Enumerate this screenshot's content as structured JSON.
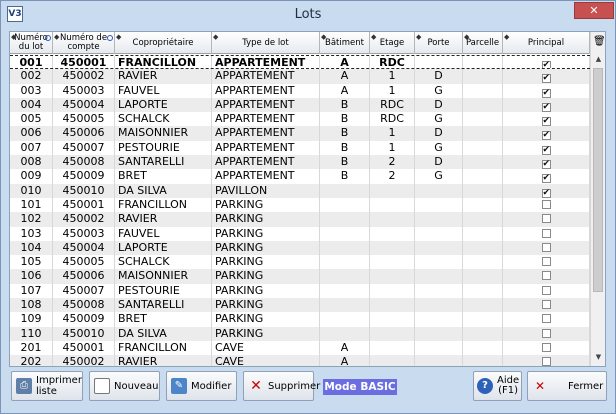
{
  "window": {
    "title": "Lots",
    "app_icon": "V3"
  },
  "columns": [
    {
      "label": "Numéro du lot",
      "key": "num"
    },
    {
      "label": "Numéro de compte",
      "key": "compte"
    },
    {
      "label": "Copropriétaire",
      "key": "prop"
    },
    {
      "label": "Type de lot",
      "key": "type"
    },
    {
      "label": "Bâtiment",
      "key": "bat"
    },
    {
      "label": "Etage",
      "key": "etage"
    },
    {
      "label": "Porte",
      "key": "porte"
    },
    {
      "label": "Parcelle",
      "key": "parc"
    },
    {
      "label": "Principal",
      "key": "princ"
    }
  ],
  "rows": [
    {
      "num": "001",
      "compte": "450001",
      "prop": "FRANCILLON",
      "type": "APPARTEMENT",
      "bat": "A",
      "etage": "RDC",
      "porte": "",
      "parc": "",
      "princ": true,
      "selected": true
    },
    {
      "num": "002",
      "compte": "450002",
      "prop": "RAVIER",
      "type": "APPARTEMENT",
      "bat": "A",
      "etage": "1",
      "porte": "D",
      "parc": "",
      "princ": true
    },
    {
      "num": "003",
      "compte": "450003",
      "prop": "FAUVEL",
      "type": "APPARTEMENT",
      "bat": "A",
      "etage": "1",
      "porte": "G",
      "parc": "",
      "princ": true
    },
    {
      "num": "004",
      "compte": "450004",
      "prop": "LAPORTE",
      "type": "APPARTEMENT",
      "bat": "B",
      "etage": "RDC",
      "porte": "D",
      "parc": "",
      "princ": true
    },
    {
      "num": "005",
      "compte": "450005",
      "prop": "SCHALCK",
      "type": "APPARTEMENT",
      "bat": "B",
      "etage": "RDC",
      "porte": "G",
      "parc": "",
      "princ": true
    },
    {
      "num": "006",
      "compte": "450006",
      "prop": "MAISONNIER",
      "type": "APPARTEMENT",
      "bat": "B",
      "etage": "1",
      "porte": "D",
      "parc": "",
      "princ": true
    },
    {
      "num": "007",
      "compte": "450007",
      "prop": "PESTOURIE",
      "type": "APPARTEMENT",
      "bat": "B",
      "etage": "1",
      "porte": "G",
      "parc": "",
      "princ": true
    },
    {
      "num": "008",
      "compte": "450008",
      "prop": "SANTARELLI",
      "type": "APPARTEMENT",
      "bat": "B",
      "etage": "2",
      "porte": "D",
      "parc": "",
      "princ": true
    },
    {
      "num": "009",
      "compte": "450009",
      "prop": "BRET",
      "type": "APPARTEMENT",
      "bat": "B",
      "etage": "2",
      "porte": "G",
      "parc": "",
      "princ": true
    },
    {
      "num": "010",
      "compte": "450010",
      "prop": "DA SILVA",
      "type": "PAVILLON",
      "bat": "",
      "etage": "",
      "porte": "",
      "parc": "",
      "princ": true
    },
    {
      "num": "101",
      "compte": "450001",
      "prop": "FRANCILLON",
      "type": "PARKING",
      "bat": "",
      "etage": "",
      "porte": "",
      "parc": "",
      "princ": false
    },
    {
      "num": "102",
      "compte": "450002",
      "prop": "RAVIER",
      "type": "PARKING",
      "bat": "",
      "etage": "",
      "porte": "",
      "parc": "",
      "princ": false
    },
    {
      "num": "103",
      "compte": "450003",
      "prop": "FAUVEL",
      "type": "PARKING",
      "bat": "",
      "etage": "",
      "porte": "",
      "parc": "",
      "princ": false
    },
    {
      "num": "104",
      "compte": "450004",
      "prop": "LAPORTE",
      "type": "PARKING",
      "bat": "",
      "etage": "",
      "porte": "",
      "parc": "",
      "princ": false
    },
    {
      "num": "105",
      "compte": "450005",
      "prop": "SCHALCK",
      "type": "PARKING",
      "bat": "",
      "etage": "",
      "porte": "",
      "parc": "",
      "princ": false
    },
    {
      "num": "106",
      "compte": "450006",
      "prop": "MAISONNIER",
      "type": "PARKING",
      "bat": "",
      "etage": "",
      "porte": "",
      "parc": "",
      "princ": false
    },
    {
      "num": "107",
      "compte": "450007",
      "prop": "PESTOURIE",
      "type": "PARKING",
      "bat": "",
      "etage": "",
      "porte": "",
      "parc": "",
      "princ": false
    },
    {
      "num": "108",
      "compte": "450008",
      "prop": "SANTARELLI",
      "type": "PARKING",
      "bat": "",
      "etage": "",
      "porte": "",
      "parc": "",
      "princ": false
    },
    {
      "num": "109",
      "compte": "450009",
      "prop": "BRET",
      "type": "PARKING",
      "bat": "",
      "etage": "",
      "porte": "",
      "parc": "",
      "princ": false
    },
    {
      "num": "110",
      "compte": "450010",
      "prop": "DA SILVA",
      "type": "PARKING",
      "bat": "",
      "etage": "",
      "porte": "",
      "parc": "",
      "princ": false
    },
    {
      "num": "201",
      "compte": "450001",
      "prop": "FRANCILLON",
      "type": "CAVE",
      "bat": "A",
      "etage": "",
      "porte": "",
      "parc": "",
      "princ": false
    },
    {
      "num": "202",
      "compte": "450002",
      "prop": "RAVIER",
      "type": "CAVE",
      "bat": "A",
      "etage": "",
      "porte": "",
      "parc": "",
      "princ": false
    }
  ],
  "toolbar": {
    "print": "Imprimer liste",
    "new": "Nouveau",
    "modify": "Modifier",
    "delete": "Supprimer",
    "mode": "Mode BASIC",
    "help_line1": "Aide",
    "help_line2": "(F1)",
    "close": "Fermer"
  },
  "icons": {
    "check": "✔",
    "close_window": "✕",
    "minimize": "—",
    "maximize": "□",
    "trash": "🗑",
    "scroll_up": "▲",
    "scroll_down": "▼"
  },
  "colors": {
    "mode_badge": "#6a6ee0",
    "close_button": "#c75050",
    "alt_row": "#ececec"
  }
}
